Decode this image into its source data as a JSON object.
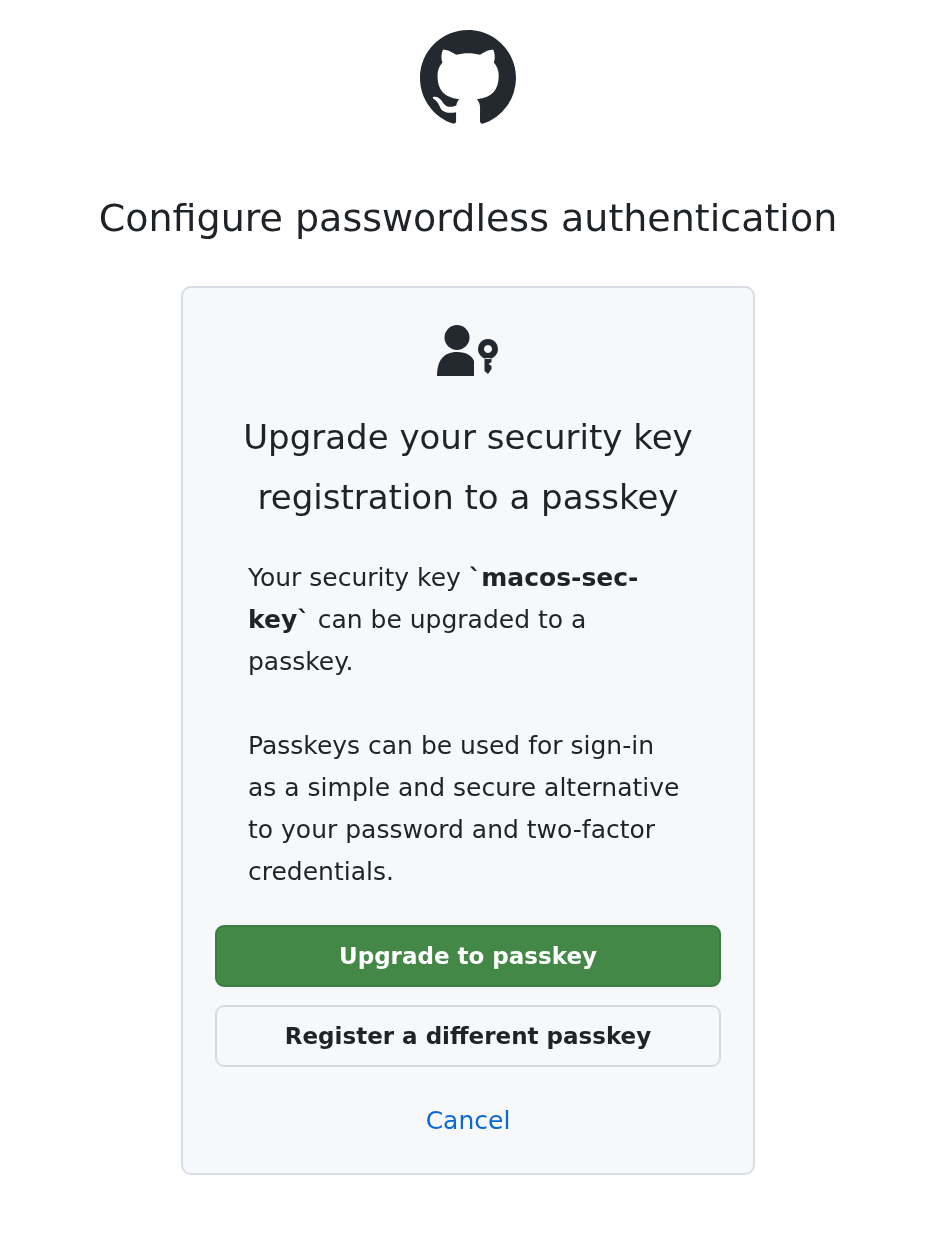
{
  "page_title": "Configure passwordless authentication",
  "card": {
    "heading": "Upgrade your security key registration to a passkey",
    "paragraphs": [
      "Your security key **`macos-sec-key`** can be upgraded to a passkey.",
      "Passkeys can be used for sign-in as a simple and secure alternative to your password and two-factor credentials."
    ],
    "buttons": [
      {
        "label": "Upgrade to passkey",
        "kind": "primary"
      },
      {
        "label": "Register a different passkey",
        "kind": "secondary"
      }
    ],
    "cancel_link": "Cancel"
  }
}
